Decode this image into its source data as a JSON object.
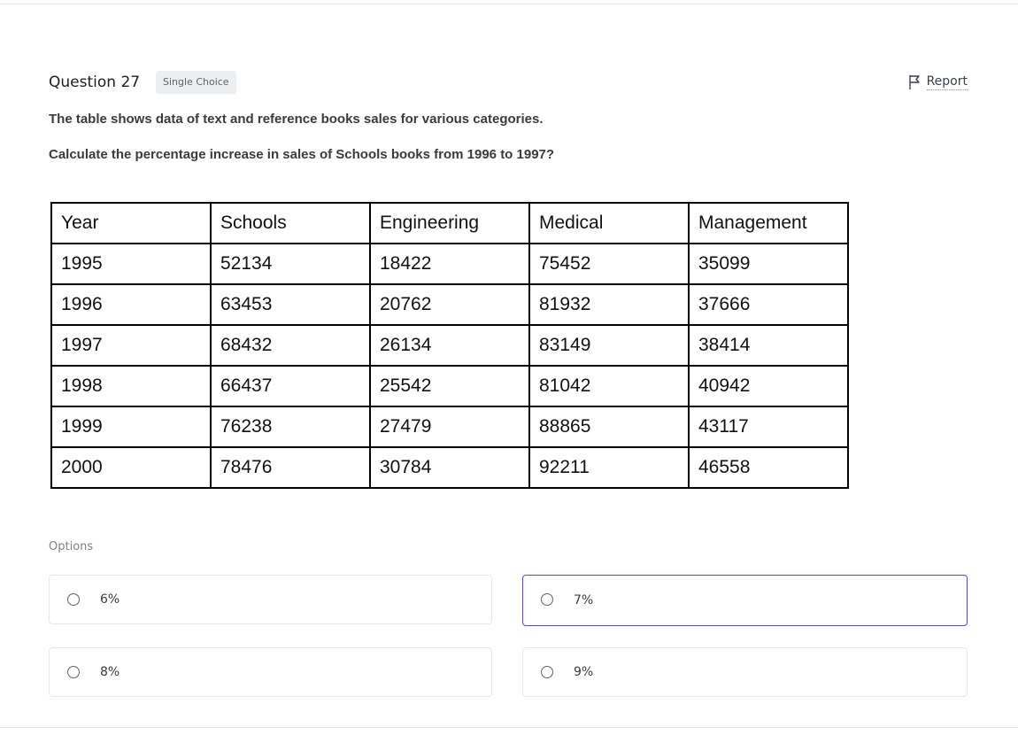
{
  "question": {
    "title": "Question 27",
    "type_badge": "Single Choice",
    "report_label": "Report",
    "text_line_1": "The table shows data of text and reference books sales for various categories.",
    "text_line_2": "Calculate the percentage increase in sales of Schools books from 1996 to 1997?"
  },
  "table": {
    "headers": [
      "Year",
      "Schools",
      "Engineering",
      "Medical",
      "Management"
    ],
    "rows": [
      [
        "1995",
        "52134",
        "18422",
        "75452",
        "35099"
      ],
      [
        "1996",
        "63453",
        "20762",
        "81932",
        "37666"
      ],
      [
        "1997",
        "68432",
        "26134",
        "83149",
        "38414"
      ],
      [
        "1998",
        "66437",
        "25542",
        "81042",
        "40942"
      ],
      [
        "1999",
        "76238",
        "27479",
        "88865",
        "43117"
      ],
      [
        "2000",
        "78476",
        "30784",
        "92211",
        "46558"
      ]
    ]
  },
  "options": {
    "label": "Options",
    "items": [
      {
        "text": "6%"
      },
      {
        "text": "7%"
      },
      {
        "text": "8%"
      },
      {
        "text": "9%"
      }
    ],
    "hover_border_color": "#5b48c9"
  },
  "icons": {
    "report": "flag-icon",
    "option_marker": "radio-circle"
  }
}
